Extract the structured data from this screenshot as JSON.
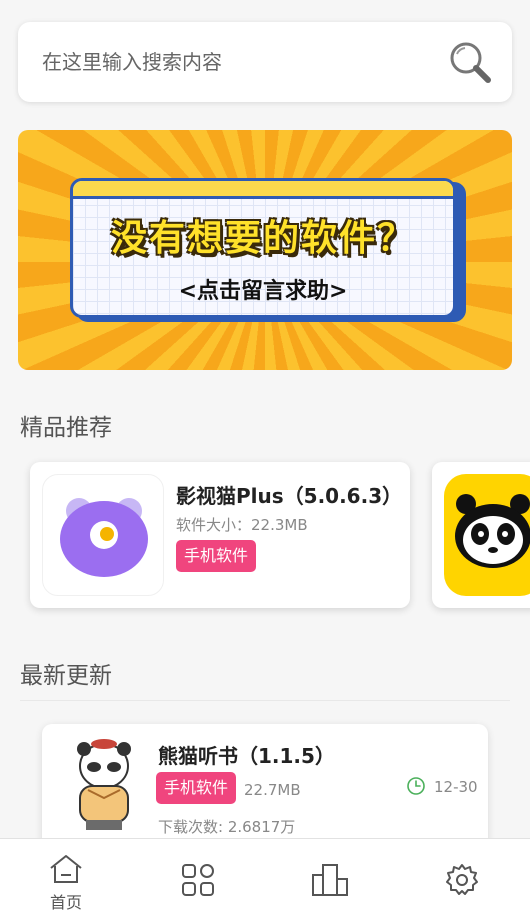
{
  "search": {
    "placeholder": "在这里输入搜索内容",
    "icon": "search-icon"
  },
  "banner": {
    "title": "没有想要的软件？",
    "subtitle": "<点击留言求助>"
  },
  "featured": {
    "title": "精品推荐",
    "items": [
      {
        "name": "影视猫Plus（5.0.6.3）",
        "size": "软件大小：22.3MB",
        "tag": "手机软件",
        "icon": "purple-cat-icon"
      },
      {
        "icon": "panda-icon"
      }
    ]
  },
  "latest": {
    "title": "最新更新",
    "items": [
      {
        "name": "熊猫听书（1.1.5）",
        "tag": "手机软件",
        "size": "22.7MB",
        "date": "12-30",
        "downloads": "下载次数: 2.6817万",
        "icon": "panda-listen-icon"
      }
    ]
  },
  "nav": {
    "items": [
      {
        "label": "首页",
        "icon": "home-icon",
        "active": true
      },
      {
        "label": "",
        "icon": "apps-icon"
      },
      {
        "label": "",
        "icon": "building-icon"
      },
      {
        "label": "",
        "icon": "gear-icon"
      }
    ]
  },
  "colors": {
    "tag": "#f0457e",
    "banner_orange": "#f7a71b",
    "banner_blue": "#2e5bb4",
    "banner_yellow": "#ffe12a",
    "time_icon_green": "#4bb05b"
  }
}
